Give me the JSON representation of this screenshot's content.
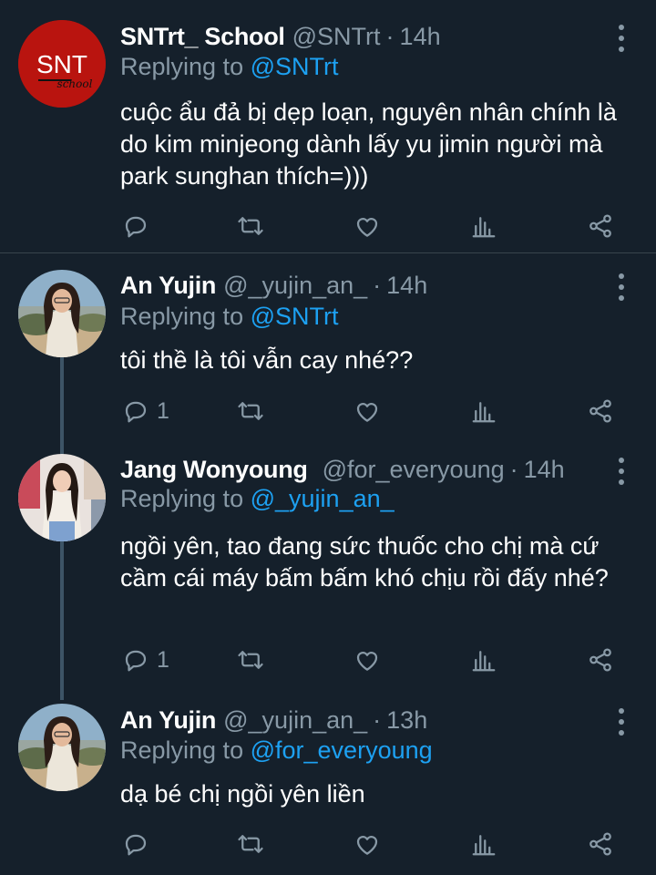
{
  "colors": {
    "background": "#15202b",
    "secondary_text": "#8899a6",
    "mention": "#1da1f2",
    "divider": "#38444d",
    "thread_line": "#3d5466",
    "snt_avatar": "#b9140f"
  },
  "tweets": [
    {
      "name": "SNTrt_ School",
      "handle": "@SNTrt",
      "separator": "·",
      "time": "14h",
      "replying_prefix": "Replying to",
      "replying_to": "@SNTrt",
      "text": "cuộc ẩu đả bị dẹp loạn, nguyên nhân chính là do kim minjeong dành lấy yu jimin người mà park sunghan thích=)))",
      "reply_count": "",
      "avatar": {
        "type": "logo",
        "logo_text": "SNT",
        "logo_subtext": "school"
      }
    },
    {
      "name": "An Yujin",
      "handle": "@_yujin_an_",
      "separator": "·",
      "time": "14h",
      "replying_prefix": "Replying to",
      "replying_to": "@SNTrt",
      "text": "tôi thề là tôi vẫn cay nhé??",
      "reply_count": "1",
      "avatar": {
        "type": "photo",
        "icon": "girl-beach-photo"
      }
    },
    {
      "name": "Jang Wonyoung",
      "handle": "@for_everyoung",
      "separator": "·",
      "time": "14h",
      "replying_prefix": "Replying to",
      "replying_to": "@_yujin_an_",
      "text": "ngồi yên, tao đang sức thuốc cho chị mà cứ cầm cái máy bấm bấm khó chịu rồi đấy nhé?",
      "reply_count": "1",
      "avatar": {
        "type": "photo",
        "icon": "girl-store-photo"
      }
    },
    {
      "name": "An Yujin",
      "handle": "@_yujin_an_",
      "separator": "·",
      "time": "13h",
      "replying_prefix": "Replying to",
      "replying_to": "@for_everyoung",
      "text": "dạ bé chị ngồi yên liền",
      "reply_count": "",
      "avatar": {
        "type": "photo",
        "icon": "girl-beach-photo"
      }
    }
  ],
  "action_icons": [
    "reply-icon",
    "retweet-icon",
    "like-icon",
    "analytics-icon",
    "share-icon"
  ]
}
